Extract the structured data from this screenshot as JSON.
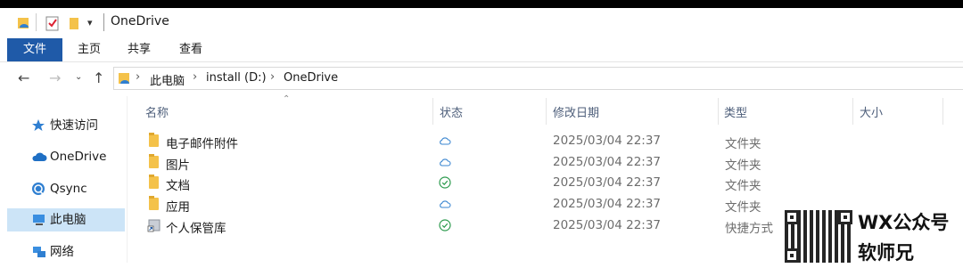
{
  "window": {
    "title": "OneDrive"
  },
  "ribbon": {
    "tabs": [
      "文件",
      "主页",
      "共享",
      "查看"
    ]
  },
  "address": {
    "crumbs": [
      "此电脑",
      "install (D:)",
      "OneDrive"
    ]
  },
  "sidebar": {
    "items": [
      {
        "label": "快速访问",
        "icon": "star-icon"
      },
      {
        "label": "OneDrive",
        "icon": "cloud-icon"
      },
      {
        "label": "Qsync",
        "icon": "sync-icon"
      },
      {
        "label": "此电脑",
        "icon": "computer-icon",
        "selected": true
      },
      {
        "label": "网络",
        "icon": "network-icon"
      }
    ]
  },
  "columns": {
    "name": "名称",
    "status": "状态",
    "date": "修改日期",
    "type": "类型",
    "size": "大小"
  },
  "files": [
    {
      "name": "电子邮件附件",
      "status": "cloud-icon",
      "date": "2025/03/04 22:37",
      "type": "文件夹",
      "icon": "folder-icon"
    },
    {
      "name": "图片",
      "status": "cloud-icon",
      "date": "2025/03/04 22:37",
      "type": "文件夹",
      "icon": "folder-icon"
    },
    {
      "name": "文档",
      "status": "check-circle-icon",
      "date": "2025/03/04 22:37",
      "type": "文件夹",
      "icon": "folder-icon"
    },
    {
      "name": "应用",
      "status": "cloud-icon",
      "date": "2025/03/04 22:37",
      "type": "文件夹",
      "icon": "folder-icon"
    },
    {
      "name": "个人保管库",
      "status": "check-circle-icon",
      "date": "2025/03/04 22:37",
      "type": "快捷方式",
      "icon": "shortcut-icon"
    }
  ],
  "watermark": {
    "line1": "WX公众号",
    "line2": "软师兄"
  },
  "colors": {
    "accent": "#1f5aa8",
    "selection": "#cce4f7",
    "cloud": "#3a86d0",
    "check": "#2e9b4f"
  }
}
